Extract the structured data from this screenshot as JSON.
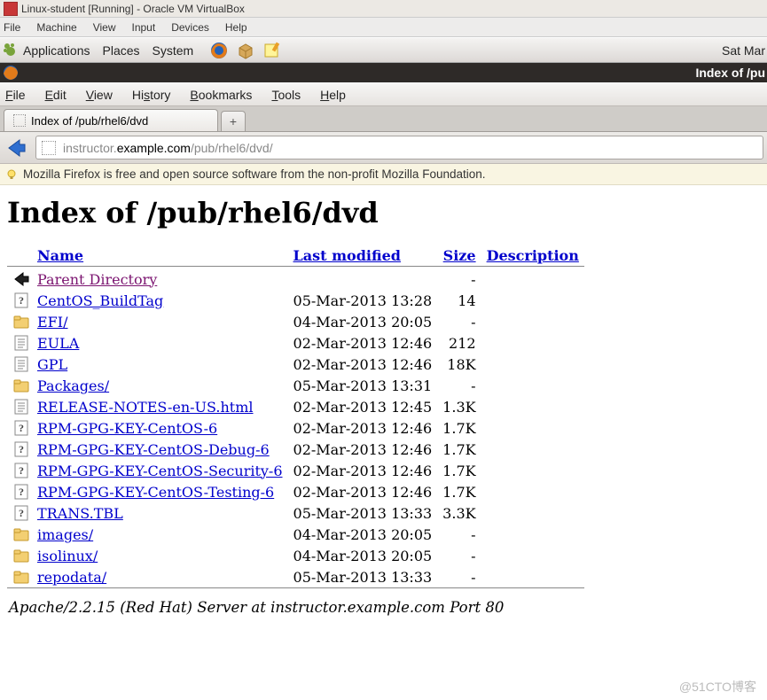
{
  "virtualbox": {
    "title": "Linux-student [Running] - Oracle VM VirtualBox",
    "menu": [
      "File",
      "Machine",
      "View",
      "Input",
      "Devices",
      "Help"
    ]
  },
  "gnome": {
    "menu_items": [
      "Applications",
      "Places",
      "System"
    ],
    "clock": "Sat Mar"
  },
  "firefox": {
    "window_title": "Index of /pu",
    "menu": {
      "file": "File",
      "edit": "Edit",
      "view": "View",
      "history": "History",
      "bookmarks": "Bookmarks",
      "tools": "Tools",
      "help": "Help"
    },
    "tab_title": "Index of /pub/rhel6/dvd",
    "newtab_glyph": "+",
    "url_host_dim": "instructor.",
    "url_host": "example.com",
    "url_path": "/pub/rhel6/dvd/",
    "info_bar": "Mozilla Firefox is free and open source software from the non-profit Mozilla Foundation."
  },
  "page": {
    "heading": "Index of /pub/rhel6/dvd",
    "columns": {
      "name": "Name",
      "modified": "Last modified",
      "size": "Size",
      "desc": "Description"
    },
    "rows": [
      {
        "icon": "back",
        "name": "Parent Directory",
        "modified": "",
        "size": "-",
        "visited": true
      },
      {
        "icon": "unknown",
        "name": "CentOS_BuildTag",
        "modified": "05-Mar-2013 13:28",
        "size": "14"
      },
      {
        "icon": "folder",
        "name": "EFI/",
        "modified": "04-Mar-2013 20:05",
        "size": "-"
      },
      {
        "icon": "text",
        "name": "EULA",
        "modified": "02-Mar-2013 12:46",
        "size": "212"
      },
      {
        "icon": "text",
        "name": "GPL",
        "modified": "02-Mar-2013 12:46",
        "size": "18K"
      },
      {
        "icon": "folder",
        "name": "Packages/",
        "modified": "05-Mar-2013 13:31",
        "size": "-"
      },
      {
        "icon": "text",
        "name": "RELEASE-NOTES-en-US.html",
        "modified": "02-Mar-2013 12:45",
        "size": "1.3K"
      },
      {
        "icon": "unknown",
        "name": "RPM-GPG-KEY-CentOS-6",
        "modified": "02-Mar-2013 12:46",
        "size": "1.7K"
      },
      {
        "icon": "unknown",
        "name": "RPM-GPG-KEY-CentOS-Debug-6",
        "modified": "02-Mar-2013 12:46",
        "size": "1.7K"
      },
      {
        "icon": "unknown",
        "name": "RPM-GPG-KEY-CentOS-Security-6",
        "modified": "02-Mar-2013 12:46",
        "size": "1.7K"
      },
      {
        "icon": "unknown",
        "name": "RPM-GPG-KEY-CentOS-Testing-6",
        "modified": "02-Mar-2013 12:46",
        "size": "1.7K"
      },
      {
        "icon": "unknown",
        "name": "TRANS.TBL",
        "modified": "05-Mar-2013 13:33",
        "size": "3.3K"
      },
      {
        "icon": "folder",
        "name": "images/",
        "modified": "04-Mar-2013 20:05",
        "size": "-"
      },
      {
        "icon": "folder",
        "name": "isolinux/",
        "modified": "04-Mar-2013 20:05",
        "size": "-"
      },
      {
        "icon": "folder",
        "name": "repodata/",
        "modified": "05-Mar-2013 13:33",
        "size": "-"
      }
    ],
    "server_line": "Apache/2.2.15 (Red Hat) Server at instructor.example.com Port 80"
  },
  "watermark": "@51CTO博客"
}
